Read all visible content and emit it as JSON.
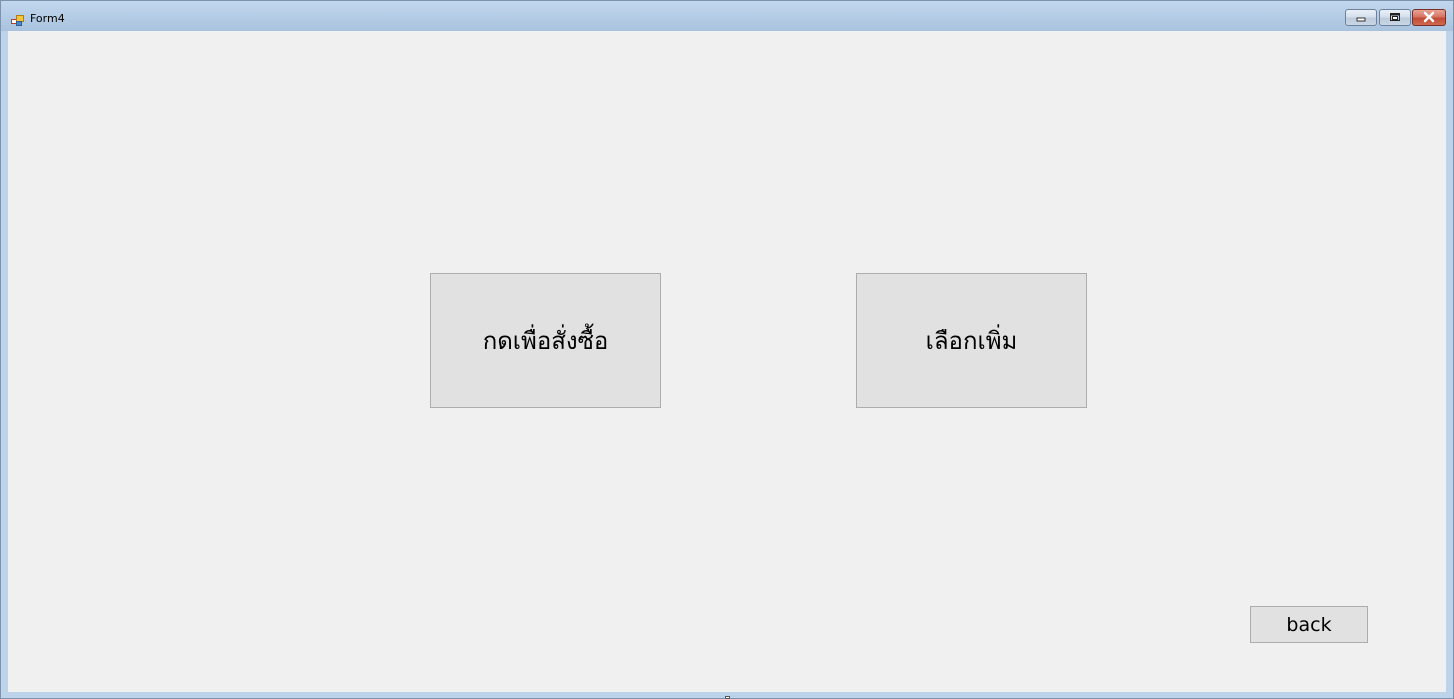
{
  "window": {
    "title": "Form4",
    "controls": {
      "minimize_icon": "minimize-icon",
      "maximize_icon": "restore-icon",
      "close_icon": "close-icon"
    }
  },
  "form": {
    "order_button_label": "กดเพื่อสั่งซื้อ",
    "more_button_label": "เลือกเพิ่ม",
    "back_button_label": "back"
  },
  "colors": {
    "client_bg": "#f0f0f0",
    "button_bg": "#e1e1e1",
    "button_border": "#adadad",
    "titlebar": "#b9d1ea",
    "close_button": "#c24b35"
  }
}
